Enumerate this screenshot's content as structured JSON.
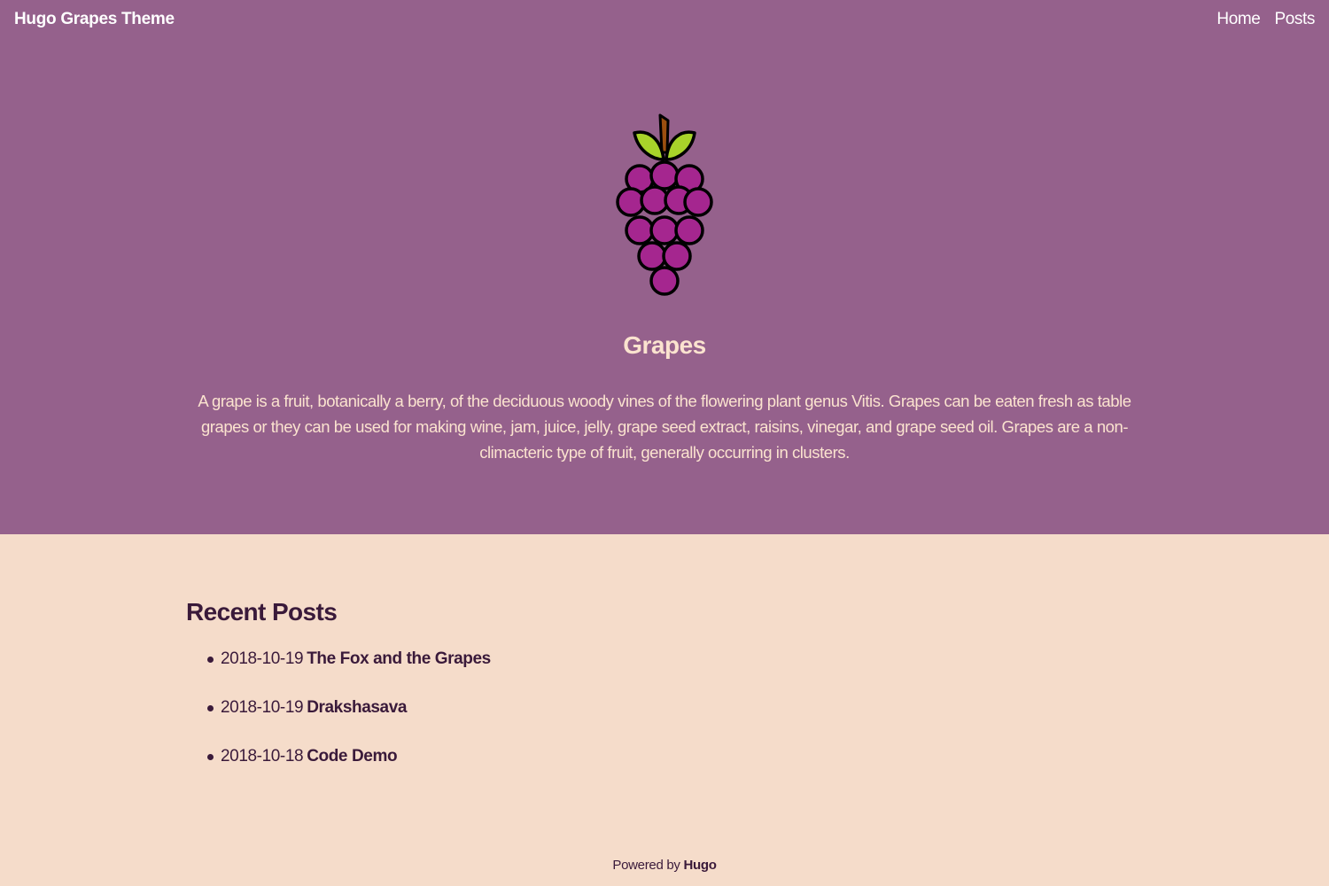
{
  "header": {
    "brand": "Hugo Grapes Theme",
    "nav": [
      {
        "label": "Home"
      },
      {
        "label": "Posts"
      }
    ]
  },
  "hero": {
    "logo_icon": "grapes-icon",
    "title": "Grapes",
    "description": "A grape is a fruit, botanically a berry, of the deciduous woody vines of the flowering plant genus Vitis. Grapes can be eaten fresh as table grapes or they can be used for making wine, jam, juice, jelly, grape seed extract, raisins, vinegar, and grape seed oil. Grapes are a non-climacteric type of fruit, generally occurring in clusters."
  },
  "recent_posts": {
    "title": "Recent Posts",
    "items": [
      {
        "date": "2018-10-19",
        "title": "The Fox and the Grapes"
      },
      {
        "date": "2018-10-19",
        "title": "Drakshasava"
      },
      {
        "date": "2018-10-18",
        "title": "Code Demo"
      }
    ]
  },
  "footer": {
    "prefix": "Powered by",
    "link": "Hugo"
  },
  "colors": {
    "hero_background": "#95618c",
    "page_background": "#f5dcca",
    "hero_text": "#fbe3cf",
    "dark_text": "#3a1a3a",
    "grape": "#a5268f",
    "leaf": "#a8d32a",
    "stem": "#9b4f0f"
  }
}
